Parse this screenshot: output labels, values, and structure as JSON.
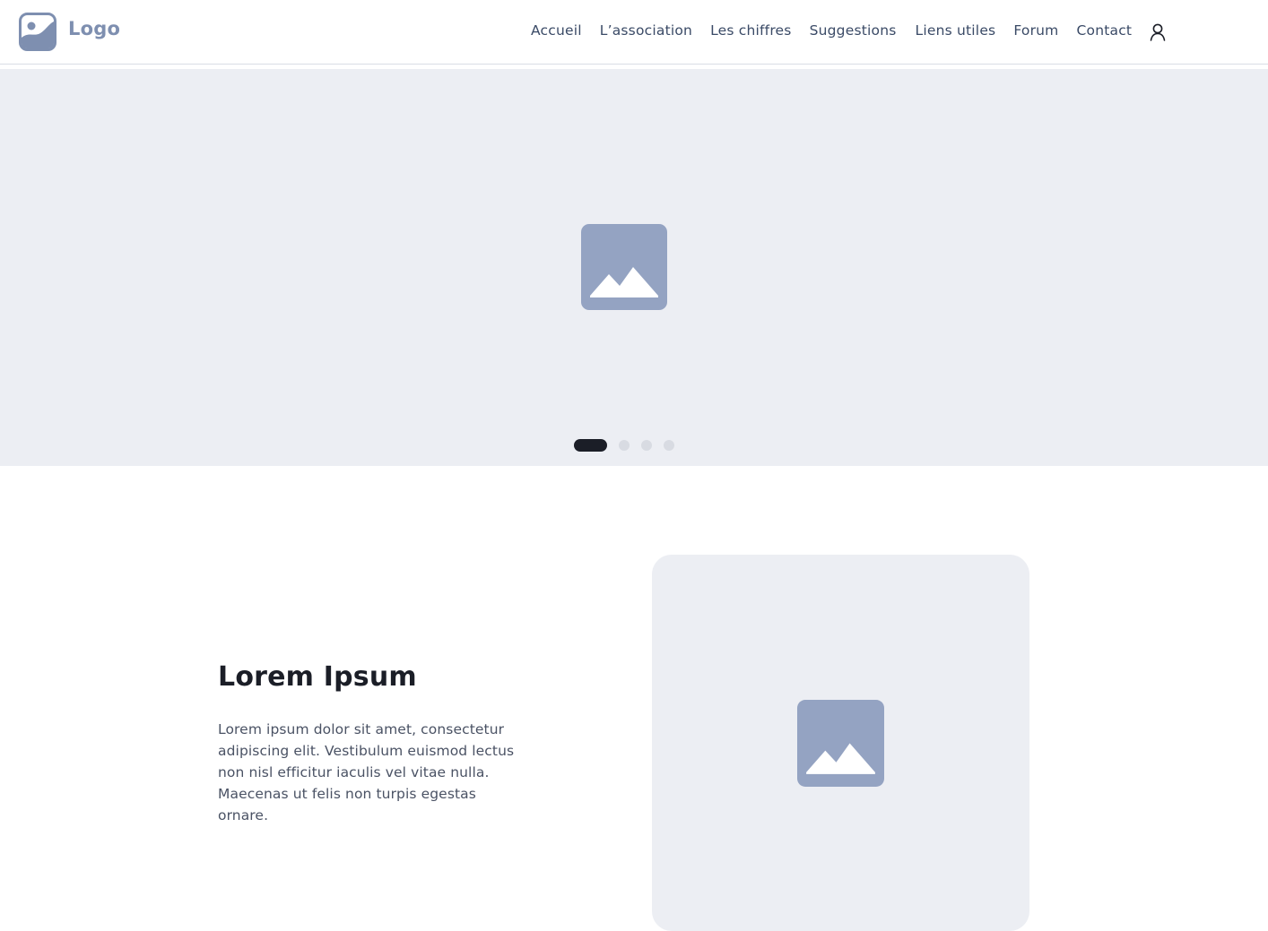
{
  "header": {
    "logo_text": "Logo",
    "nav": [
      {
        "label": "Accueil",
        "name": "nav-accueil"
      },
      {
        "label": "L’association",
        "name": "nav-association"
      },
      {
        "label": "Les chiffres",
        "name": "nav-les-chiffres"
      },
      {
        "label": "Suggestions",
        "name": "nav-suggestions"
      },
      {
        "label": "Liens utiles",
        "name": "nav-liens-utiles"
      },
      {
        "label": "Forum",
        "name": "nav-forum"
      },
      {
        "label": "Contact",
        "name": "nav-contact"
      }
    ],
    "user_icon": "user-icon"
  },
  "hero": {
    "image_icon": "image-placeholder-icon",
    "slides_total": 4,
    "active_slide": 1
  },
  "feature": {
    "title": "Lorem Ipsum",
    "body": "Lorem ipsum dolor sit amet, consectetur adipiscing elit. Vestibulum euismod lectus non nisl efficitur iaculis vel vitae nulla. Maecenas ut felis non turpis egestas ornare.",
    "image_icon": "image-placeholder-icon"
  },
  "colors": {
    "placeholder_bg": "#eceef3",
    "placeholder_icon": "#94a3c2",
    "logo": "#7e8fb0",
    "nav_text": "#3a4a66",
    "dark": "#1b1e27",
    "dot_inactive": "#d8dbe2"
  }
}
